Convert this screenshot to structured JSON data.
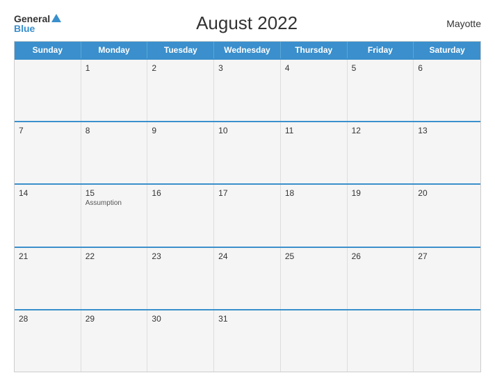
{
  "header": {
    "logo_general": "General",
    "logo_blue": "Blue",
    "title": "August 2022",
    "region": "Mayotte"
  },
  "days_of_week": [
    "Sunday",
    "Monday",
    "Tuesday",
    "Wednesday",
    "Thursday",
    "Friday",
    "Saturday"
  ],
  "weeks": [
    [
      {
        "day": "",
        "event": ""
      },
      {
        "day": "1",
        "event": ""
      },
      {
        "day": "2",
        "event": ""
      },
      {
        "day": "3",
        "event": ""
      },
      {
        "day": "4",
        "event": ""
      },
      {
        "day": "5",
        "event": ""
      },
      {
        "day": "6",
        "event": ""
      }
    ],
    [
      {
        "day": "7",
        "event": ""
      },
      {
        "day": "8",
        "event": ""
      },
      {
        "day": "9",
        "event": ""
      },
      {
        "day": "10",
        "event": ""
      },
      {
        "day": "11",
        "event": ""
      },
      {
        "day": "12",
        "event": ""
      },
      {
        "day": "13",
        "event": ""
      }
    ],
    [
      {
        "day": "14",
        "event": ""
      },
      {
        "day": "15",
        "event": "Assumption"
      },
      {
        "day": "16",
        "event": ""
      },
      {
        "day": "17",
        "event": ""
      },
      {
        "day": "18",
        "event": ""
      },
      {
        "day": "19",
        "event": ""
      },
      {
        "day": "20",
        "event": ""
      }
    ],
    [
      {
        "day": "21",
        "event": ""
      },
      {
        "day": "22",
        "event": ""
      },
      {
        "day": "23",
        "event": ""
      },
      {
        "day": "24",
        "event": ""
      },
      {
        "day": "25",
        "event": ""
      },
      {
        "day": "26",
        "event": ""
      },
      {
        "day": "27",
        "event": ""
      }
    ],
    [
      {
        "day": "28",
        "event": ""
      },
      {
        "day": "29",
        "event": ""
      },
      {
        "day": "30",
        "event": ""
      },
      {
        "day": "31",
        "event": ""
      },
      {
        "day": "",
        "event": ""
      },
      {
        "day": "",
        "event": ""
      },
      {
        "day": "",
        "event": ""
      }
    ]
  ]
}
